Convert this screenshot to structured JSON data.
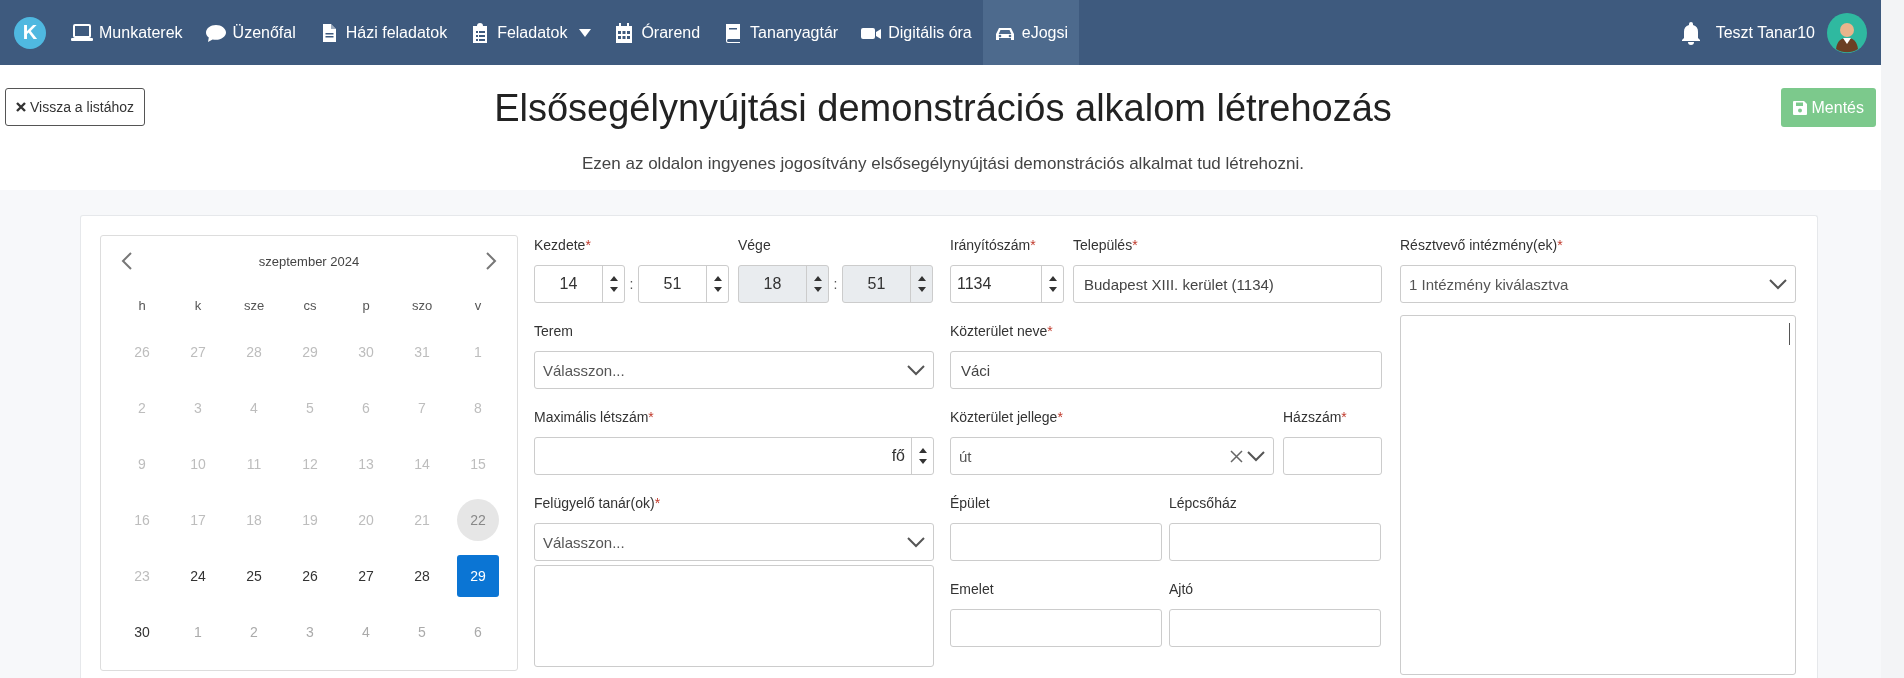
{
  "navbar": {
    "logo": "K",
    "items": [
      {
        "label": "Munkaterek",
        "dropdown": false,
        "selected": false
      },
      {
        "label": "Üzenőfal",
        "dropdown": false,
        "selected": false
      },
      {
        "label": "Házi feladatok",
        "dropdown": false,
        "selected": false
      },
      {
        "label": "Feladatok",
        "dropdown": true,
        "selected": false
      },
      {
        "label": "Órarend",
        "dropdown": false,
        "selected": false
      },
      {
        "label": "Tananyagtár",
        "dropdown": false,
        "selected": false
      },
      {
        "label": "Digitális óra",
        "dropdown": false,
        "selected": false
      },
      {
        "label": "eJogsi",
        "dropdown": false,
        "selected": true
      }
    ],
    "user": {
      "name": "Teszt Tanar10"
    }
  },
  "header": {
    "back_button": "Vissza a listához",
    "title": "Elsősegélynyújtási demonstrációs alkalom létrehozás",
    "subtitle": "Ezen az oldalon ingyenes jogosítvány elsősegélynyújtási demonstrációs alkalmat tud létrehozni.",
    "save_button": "Mentés"
  },
  "calendar": {
    "month": "szeptember 2024",
    "weekdays": [
      "h",
      "k",
      "sze",
      "cs",
      "p",
      "szo",
      "v"
    ],
    "days": [
      {
        "label": "26",
        "outside": true,
        "disabled": true,
        "today": false,
        "selected": false
      },
      {
        "label": "27",
        "outside": true,
        "disabled": true,
        "today": false,
        "selected": false
      },
      {
        "label": "28",
        "outside": true,
        "disabled": true,
        "today": false,
        "selected": false
      },
      {
        "label": "29",
        "outside": true,
        "disabled": true,
        "today": false,
        "selected": false
      },
      {
        "label": "30",
        "outside": true,
        "disabled": true,
        "today": false,
        "selected": false
      },
      {
        "label": "31",
        "outside": true,
        "disabled": true,
        "today": false,
        "selected": false
      },
      {
        "label": "1",
        "outside": false,
        "disabled": true,
        "today": false,
        "selected": false
      },
      {
        "label": "2",
        "outside": false,
        "disabled": true,
        "today": false,
        "selected": false
      },
      {
        "label": "3",
        "outside": false,
        "disabled": true,
        "today": false,
        "selected": false
      },
      {
        "label": "4",
        "outside": false,
        "disabled": true,
        "today": false,
        "selected": false
      },
      {
        "label": "5",
        "outside": false,
        "disabled": true,
        "today": false,
        "selected": false
      },
      {
        "label": "6",
        "outside": false,
        "disabled": true,
        "today": false,
        "selected": false
      },
      {
        "label": "7",
        "outside": false,
        "disabled": true,
        "today": false,
        "selected": false
      },
      {
        "label": "8",
        "outside": false,
        "disabled": true,
        "today": false,
        "selected": false
      },
      {
        "label": "9",
        "outside": false,
        "disabled": true,
        "today": false,
        "selected": false
      },
      {
        "label": "10",
        "outside": false,
        "disabled": true,
        "today": false,
        "selected": false
      },
      {
        "label": "11",
        "outside": false,
        "disabled": true,
        "today": false,
        "selected": false
      },
      {
        "label": "12",
        "outside": false,
        "disabled": true,
        "today": false,
        "selected": false
      },
      {
        "label": "13",
        "outside": false,
        "disabled": true,
        "today": false,
        "selected": false
      },
      {
        "label": "14",
        "outside": false,
        "disabled": true,
        "today": false,
        "selected": false
      },
      {
        "label": "15",
        "outside": false,
        "disabled": true,
        "today": false,
        "selected": false
      },
      {
        "label": "16",
        "outside": false,
        "disabled": true,
        "today": false,
        "selected": false
      },
      {
        "label": "17",
        "outside": false,
        "disabled": true,
        "today": false,
        "selected": false
      },
      {
        "label": "18",
        "outside": false,
        "disabled": true,
        "today": false,
        "selected": false
      },
      {
        "label": "19",
        "outside": false,
        "disabled": true,
        "today": false,
        "selected": false
      },
      {
        "label": "20",
        "outside": false,
        "disabled": true,
        "today": false,
        "selected": false
      },
      {
        "label": "21",
        "outside": false,
        "disabled": true,
        "today": false,
        "selected": false
      },
      {
        "label": "22",
        "outside": false,
        "disabled": true,
        "today": true,
        "selected": false
      },
      {
        "label": "23",
        "outside": false,
        "disabled": true,
        "today": false,
        "selected": false
      },
      {
        "label": "24",
        "outside": false,
        "disabled": false,
        "today": false,
        "selected": false
      },
      {
        "label": "25",
        "outside": false,
        "disabled": false,
        "today": false,
        "selected": false
      },
      {
        "label": "26",
        "outside": false,
        "disabled": false,
        "today": false,
        "selected": false
      },
      {
        "label": "27",
        "outside": false,
        "disabled": false,
        "today": false,
        "selected": false
      },
      {
        "label": "28",
        "outside": false,
        "disabled": false,
        "today": false,
        "selected": false
      },
      {
        "label": "29",
        "outside": false,
        "disabled": false,
        "today": false,
        "selected": true
      },
      {
        "label": "30",
        "outside": false,
        "disabled": false,
        "today": false,
        "selected": false
      },
      {
        "label": "1",
        "outside": true,
        "disabled": false,
        "today": false,
        "selected": false
      },
      {
        "label": "2",
        "outside": true,
        "disabled": false,
        "today": false,
        "selected": false
      },
      {
        "label": "3",
        "outside": true,
        "disabled": false,
        "today": false,
        "selected": false
      },
      {
        "label": "4",
        "outside": true,
        "disabled": false,
        "today": false,
        "selected": false
      },
      {
        "label": "5",
        "outside": true,
        "disabled": false,
        "today": false,
        "selected": false
      },
      {
        "label": "6",
        "outside": true,
        "disabled": false,
        "today": false,
        "selected": false
      }
    ]
  },
  "form": {
    "start": {
      "label": "Kezdete",
      "required_mark": "*",
      "hour": "14",
      "separator": ":",
      "minute": "51",
      "disabled": false
    },
    "end": {
      "label": "Vége",
      "hour": "18",
      "separator": ":",
      "minute": "51",
      "disabled": true
    },
    "room": {
      "label": "Terem",
      "placeholder": "Válasszon..."
    },
    "max_count": {
      "label": "Maximális létszám",
      "required_mark": "*",
      "unit": "fő"
    },
    "supervisors": {
      "label": "Felügyelő tanár(ok)",
      "required_mark": "*",
      "placeholder": "Válasszon..."
    },
    "zip": {
      "label": "Irányítószám",
      "required_mark": "*",
      "value": "1134"
    },
    "city": {
      "label": "Település",
      "required_mark": "*",
      "value": "Budapest XIII. kerület (1134)"
    },
    "street_name": {
      "label": "Közterület neve",
      "required_mark": "*",
      "value": "Váci"
    },
    "street_type": {
      "label": "Közterület jellege",
      "required_mark": "*",
      "value": "út",
      "clearable": true
    },
    "house_number": {
      "label": "Házszám",
      "required_mark": "*"
    },
    "building": {
      "label": "Épület"
    },
    "staircase": {
      "label": "Lépcsőház"
    },
    "floor": {
      "label": "Emelet"
    },
    "door": {
      "label": "Ajtó"
    },
    "institutions": {
      "label": "Résztvevő intézmény(ek)",
      "required_mark": "*",
      "value": "1 Intézmény kiválasztva"
    }
  }
}
